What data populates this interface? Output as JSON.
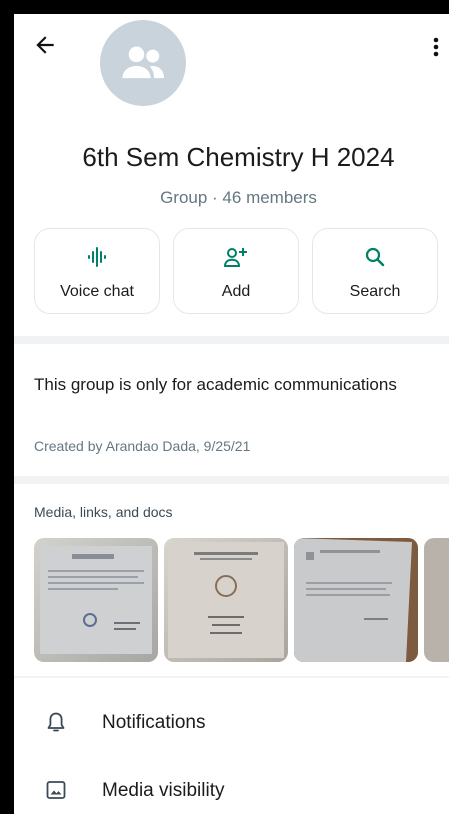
{
  "header": {
    "title": "6th Sem Chemistry H 2024",
    "subtitle": "Group · 46 members"
  },
  "actions": [
    {
      "label": "Voice chat",
      "icon": "voice-chat-icon"
    },
    {
      "label": "Add",
      "icon": "add-person-icon"
    },
    {
      "label": "Search",
      "icon": "search-icon"
    }
  ],
  "description": {
    "text": "This group is only for academic communications",
    "created": "Created by Arandao Dada, 9/25/21"
  },
  "media": {
    "heading": "Media, links, and docs"
  },
  "settings": [
    {
      "label": "Notifications",
      "icon": "bell-icon"
    },
    {
      "label": "Media visibility",
      "icon": "image-icon"
    }
  ],
  "colors": {
    "accent": "#008069",
    "muted": "#667781",
    "divider": "#f0f2f3",
    "avatar_bg": "#c9d3dc"
  }
}
